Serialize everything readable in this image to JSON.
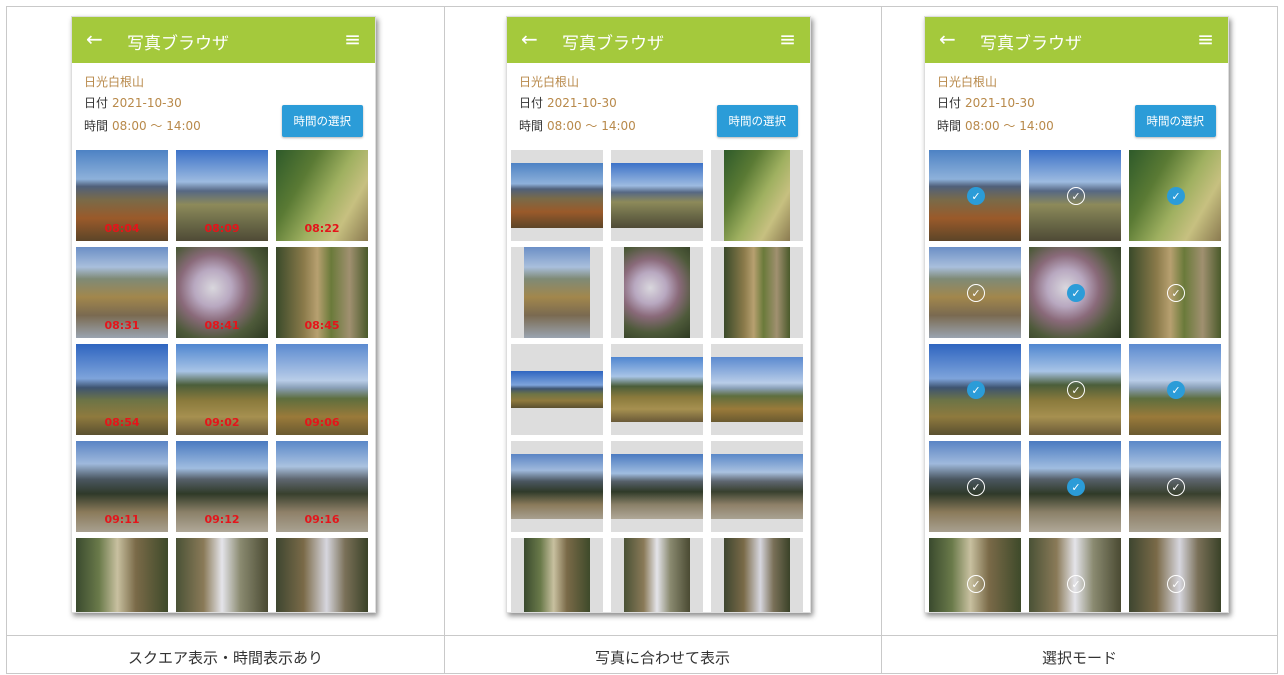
{
  "colors": {
    "appbar": "#a4c93c",
    "accent_text": "#b8894a",
    "button": "#2b9cd8",
    "time_label": "#e4151b"
  },
  "app": {
    "back_icon": "←",
    "title": "写真ブラウザ",
    "menu_icon": "≡",
    "location": "日光白根山",
    "date_label": "日付",
    "date_value": "2021-10-30",
    "time_label": "時間",
    "time_value": "08:00 〜 14:00",
    "select_button": "時間の選択"
  },
  "captions": [
    "スクエア表示・時間表示あり",
    "写真に合わせて表示",
    "選択モード"
  ],
  "time_labels": [
    "08:04",
    "08:09",
    "08:22",
    "08:31",
    "08:41",
    "08:45",
    "08:54",
    "09:02",
    "09:06",
    "09:11",
    "09:12",
    "09:16"
  ],
  "selection": [
    true,
    false,
    true,
    false,
    true,
    false,
    true,
    false,
    true,
    false,
    true,
    false,
    false,
    false,
    false
  ]
}
